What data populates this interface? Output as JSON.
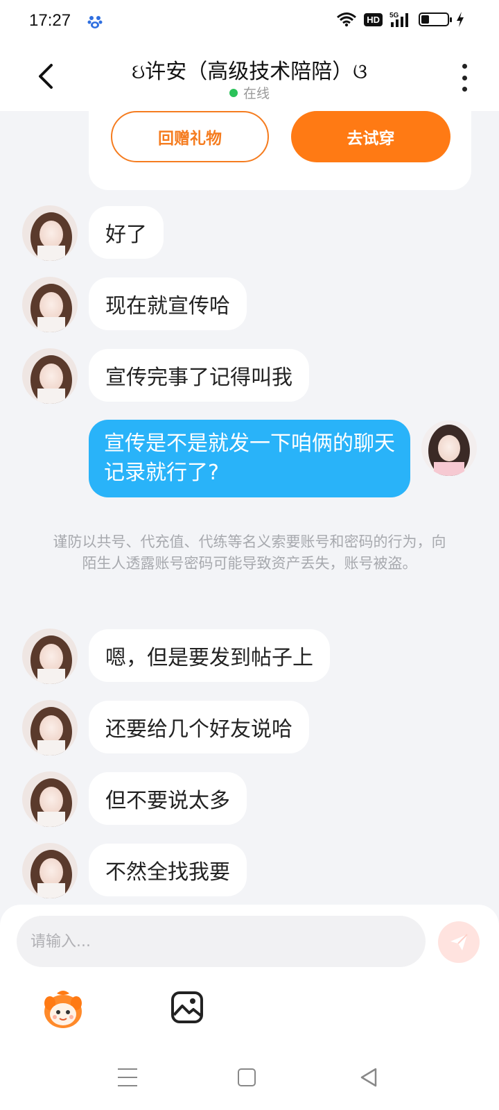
{
  "status_bar": {
    "time": "17:27",
    "network_badge": "HD",
    "signal_label": "5G",
    "battery_level": 0.3
  },
  "header": {
    "title": "ઇ许安（高级技术陪陪）ଓ",
    "online_status": "在线"
  },
  "gift_card": {
    "return_gift_label": "回赠礼物",
    "try_on_label": "去试穿"
  },
  "messages": [
    {
      "from": "other",
      "text": "好了"
    },
    {
      "from": "other",
      "text": "现在就宣传哈"
    },
    {
      "from": "other",
      "text": "宣传完事了记得叫我"
    },
    {
      "from": "me",
      "text": "宣传是不是就发一下咱俩的聊天记录就行了?"
    },
    {
      "from": "other",
      "text": "嗯，但是要发到帖子上"
    },
    {
      "from": "other",
      "text": "还要给几个好友说哈"
    },
    {
      "from": "other",
      "text": "但不要说太多"
    },
    {
      "from": "other",
      "text": "不然全找我要"
    }
  ],
  "notice": "谨防以共号、代充值、代练等名义索要账号和密码的行为，向陌生人透露账号密码可能导致资产丢失，账号被盗。",
  "input": {
    "placeholder": "请输入..."
  },
  "colors": {
    "accent_orange": "#ff7a14",
    "my_bubble": "#29b3f9",
    "online_green": "#2bc25a",
    "send_disabled": "#ffe3df"
  },
  "icons": [
    "back-icon",
    "more-icon",
    "send-icon",
    "mascot-emoji-icon",
    "image-icon",
    "menu-icon",
    "home-icon",
    "nav-back-icon"
  ]
}
